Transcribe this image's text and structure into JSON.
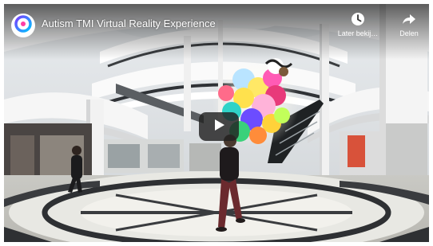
{
  "video": {
    "title": "Autism TMI Virtual Reality Experience"
  },
  "actions": {
    "watch_later_label": "Later bekij…",
    "share_label": "Delen"
  },
  "colors": {
    "overlay_text": "#ffffff",
    "play_button_bg": "#212121",
    "channel_logo_gradient": [
      "#7a3cff",
      "#00c3ff"
    ]
  },
  "icons": {
    "channel": "channel-logo-icon",
    "watch_later": "clock-icon",
    "share": "share-arrow-icon",
    "play": "play-icon"
  }
}
